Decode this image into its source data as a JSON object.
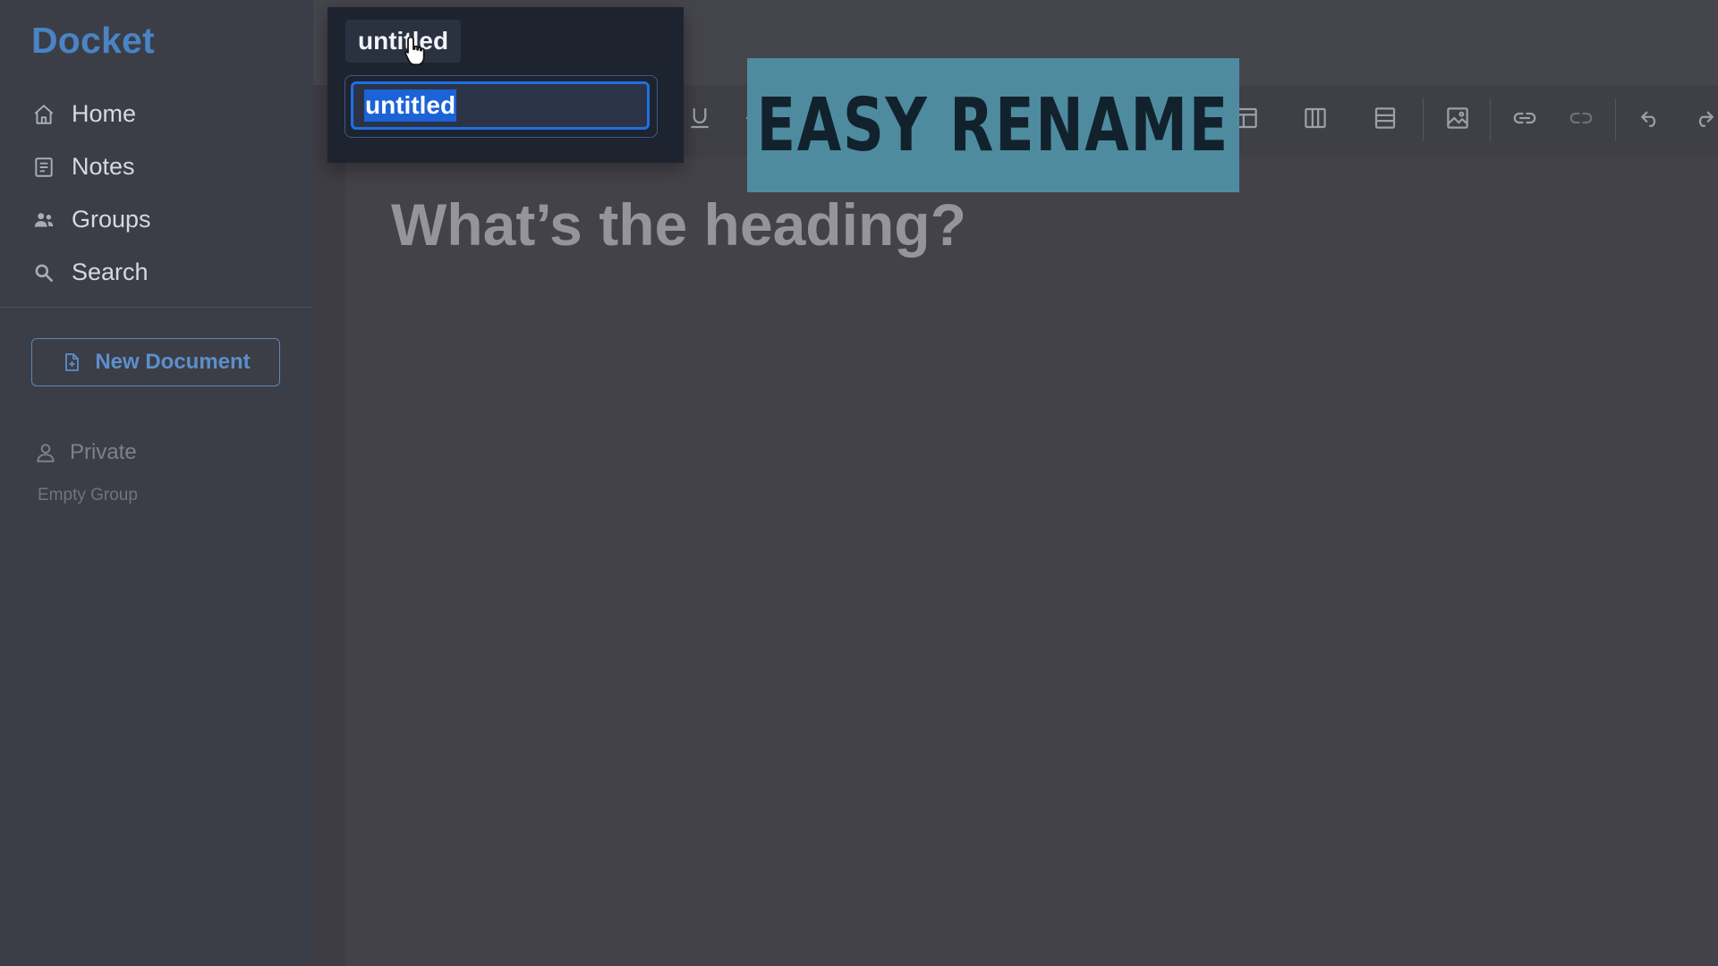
{
  "app": {
    "name": "Docket"
  },
  "sidebar": {
    "nav": [
      {
        "label": "Home",
        "icon": "home-icon"
      },
      {
        "label": "Notes",
        "icon": "notes-icon"
      },
      {
        "label": "Groups",
        "icon": "groups-icon"
      },
      {
        "label": "Search",
        "icon": "search-icon"
      }
    ],
    "new_document_label": "New Document",
    "group": {
      "name": "Private",
      "empty_text": "Empty Group"
    }
  },
  "document": {
    "title": "untitled",
    "rename_value": "untitled",
    "heading_placeholder": "What’s the heading?"
  },
  "toolbar": {
    "icons": [
      "underline-icon",
      "strikethrough-icon",
      "highlight-icon",
      "align-left-icon",
      "align-center-icon",
      "align-right-icon",
      "align-justify-icon",
      "list-icon",
      "table-icon",
      "table-columns-icon",
      "table-rows-icon",
      "image-icon",
      "link-icon",
      "unlink-icon",
      "undo-icon",
      "redo-icon"
    ]
  },
  "overlay": {
    "banner_text": "EASY RENAME",
    "banner_color": "#4f8b9f"
  },
  "colors": {
    "accent": "#4a84c4",
    "selection": "#1c63d8",
    "background": "#434249"
  }
}
